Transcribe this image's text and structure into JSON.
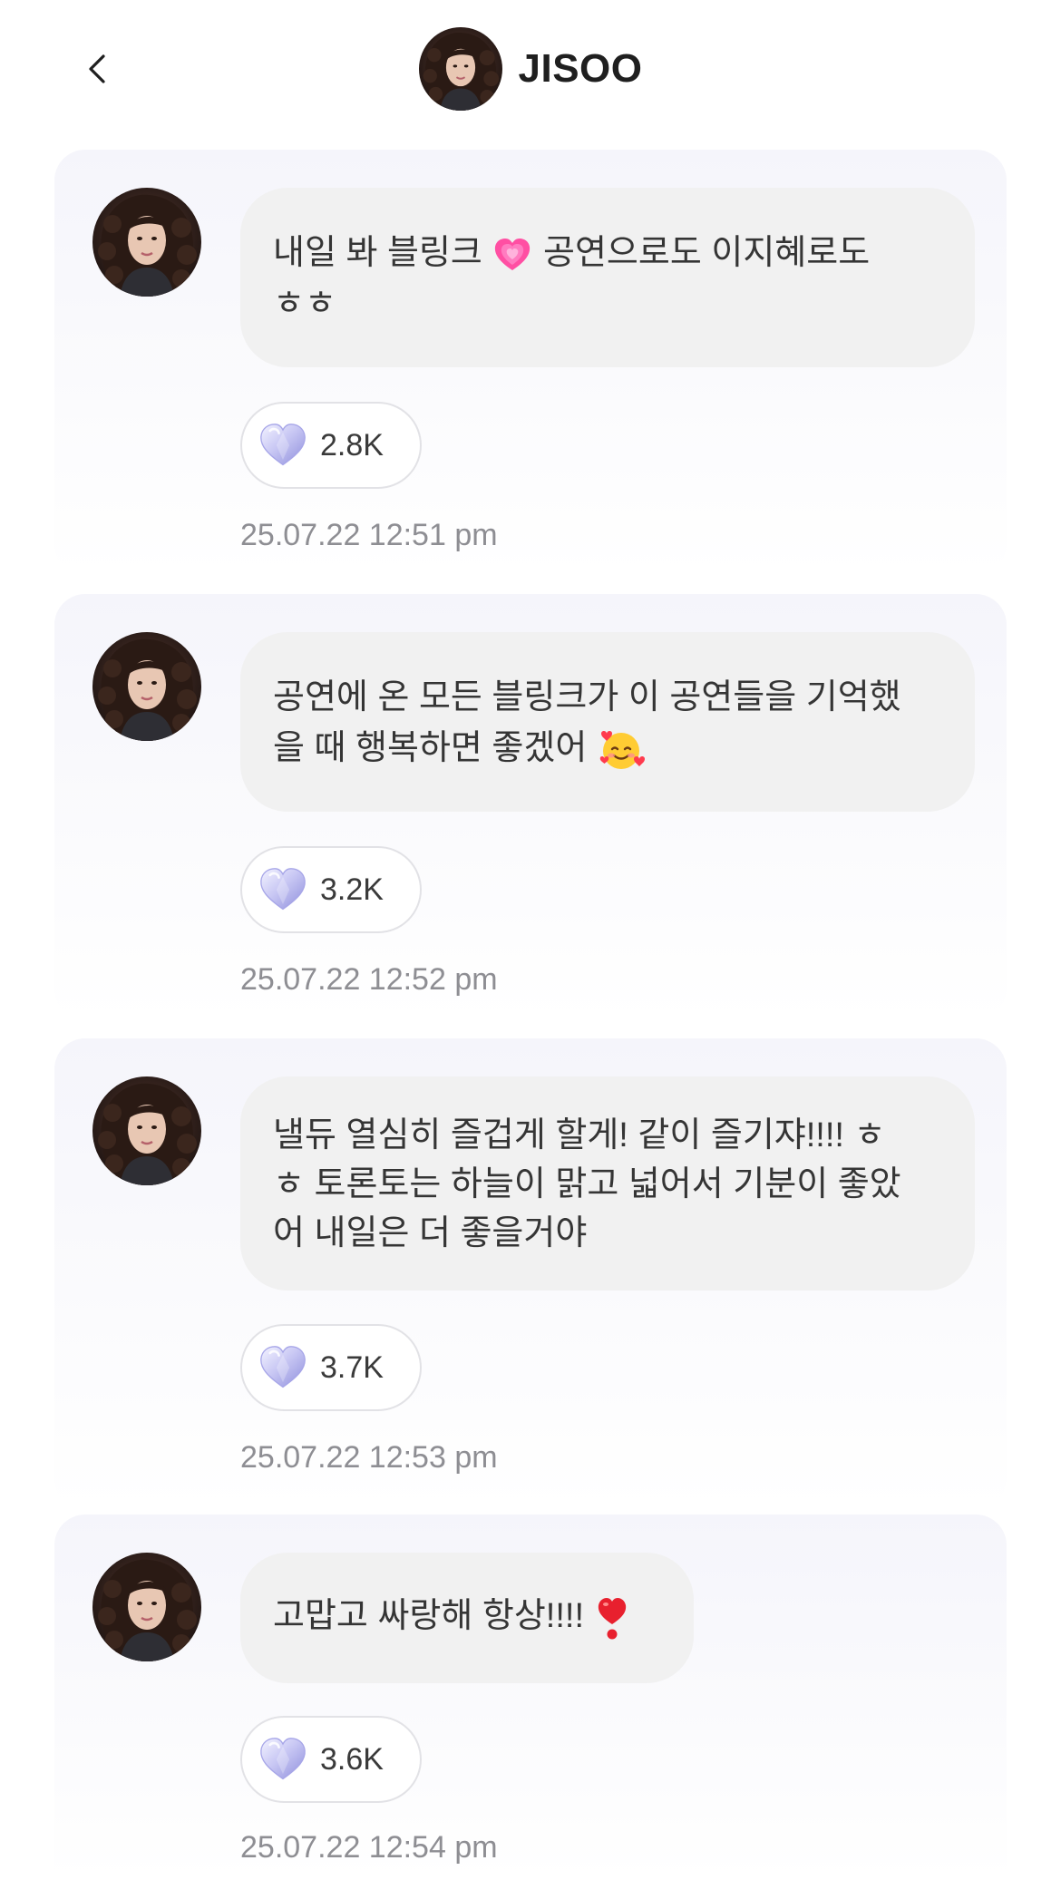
{
  "header": {
    "title": "JISOO",
    "back_icon": "chevron-left-icon"
  },
  "posts": [
    {
      "text_before": "내일 봐 블링크 ",
      "emoji": "growing-heart-emoji",
      "text_after": " 공연으로도 이지혜로도\nㅎㅎ",
      "likes": "2.8K",
      "timestamp": "25.07.22 12:51 pm"
    },
    {
      "text_before": "공연에 온 모든 블링크가 이 공연들을 기억했\n을 때 행복하면 좋겠어 ",
      "emoji": "smiling-face-with-hearts-emoji",
      "text_after": "",
      "likes": "3.2K",
      "timestamp": "25.07.22 12:52 pm"
    },
    {
      "text_before": "낼듀 열심히 즐겁게 할게! 같이 즐기쟈!!!! ㅎ\nㅎ 토론토는 하늘이 맑고 넓어서 기분이 좋았\n어 내일은 더 좋을거야",
      "emoji": "",
      "text_after": "",
      "likes": "3.7K",
      "timestamp": "25.07.22 12:53 pm"
    },
    {
      "text_before": "고맙고 싸랑해 항상!!!! ",
      "emoji": "red-exclamation-heart-emoji",
      "text_after": "",
      "likes": "3.6K",
      "timestamp": "25.07.22 12:54 pm"
    }
  ],
  "colors": {
    "background": "#ffffff",
    "card": "#f5f5fb",
    "bubble": "#f1f1f1",
    "heart_accent": "#b8b9f0",
    "timestamp": "#8e8e93"
  }
}
